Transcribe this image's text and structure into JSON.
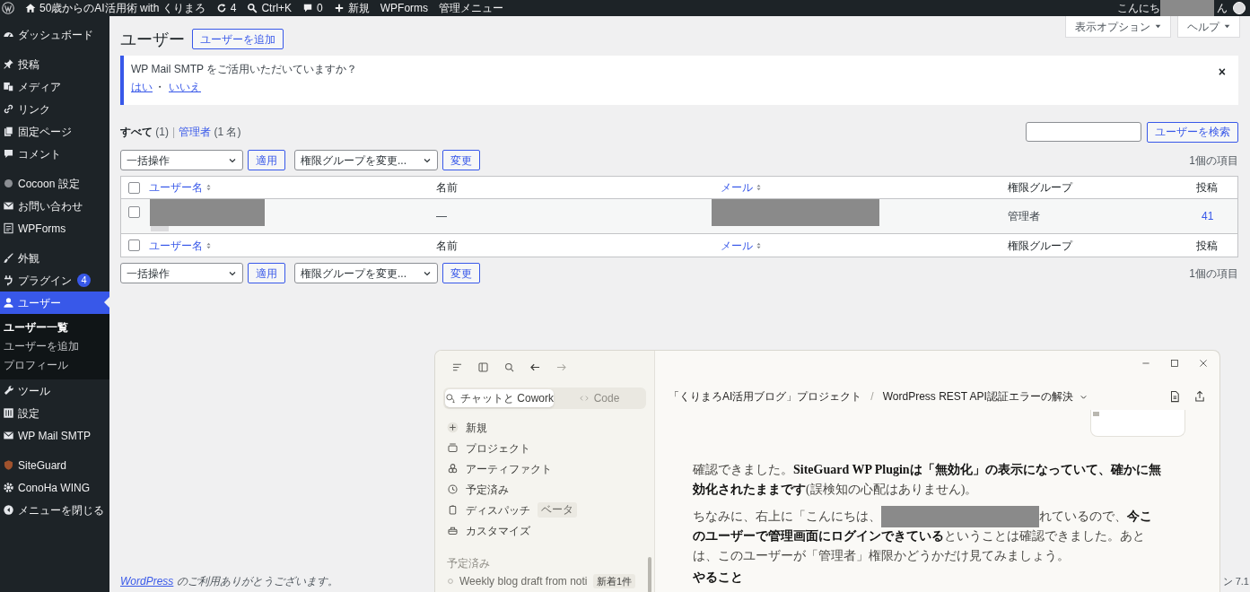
{
  "admin_bar": {
    "site_title": "50歳からのAI活用術 with くりまろ",
    "updates": "4",
    "search_shortcut": "Ctrl+K",
    "comments": "0",
    "new_label": "新規",
    "items": [
      "WPForms",
      "管理メニュー"
    ],
    "greeting_start": "こんにち",
    "greeting_end": "ん"
  },
  "sidebar": {
    "groups": [
      [
        {
          "label": "ダッシュボード",
          "selected": false
        }
      ],
      [
        {
          "label": "投稿",
          "selected": false
        },
        {
          "label": "メディア",
          "selected": false
        },
        {
          "label": "リンク",
          "selected": false
        },
        {
          "label": "固定ページ",
          "selected": false
        },
        {
          "label": "コメント",
          "selected": false
        }
      ],
      [
        {
          "label": "Cocoon 設定",
          "selected": false
        },
        {
          "label": "お問い合わせ",
          "selected": false
        },
        {
          "label": "WPForms",
          "selected": false
        }
      ],
      [
        {
          "label": "外観",
          "selected": false
        },
        {
          "label": "プラグイン",
          "badge": "4",
          "selected": false
        },
        {
          "label": "ユーザー",
          "selected": true,
          "children": [
            {
              "label": "ユーザー一覧",
              "selected": true
            },
            {
              "label": "ユーザーを追加",
              "selected": false
            },
            {
              "label": "プロフィール",
              "selected": false
            }
          ]
        },
        {
          "label": "ツール",
          "selected": false
        },
        {
          "label": "設定",
          "selected": false
        },
        {
          "label": "WP Mail SMTP",
          "selected": false
        }
      ],
      [
        {
          "label": "SiteGuard",
          "selected": false
        },
        {
          "label": "ConoHa WING",
          "selected": false
        },
        {
          "label": "メニューを閉じる",
          "selected": false
        }
      ]
    ]
  },
  "screen_tabs": [
    {
      "label": "表示オプション"
    },
    {
      "label": "ヘルプ"
    }
  ],
  "page": {
    "title": "ユーザー",
    "add_button": "ユーザーを追加"
  },
  "notice": {
    "message": "WP Mail SMTP をご活用いただいていますか？",
    "links": [
      "はい",
      "いいえ"
    ],
    "separator": "・",
    "dismiss": "×"
  },
  "filters": [
    {
      "label": "すべて",
      "count": "(1)",
      "selected": true
    },
    {
      "label": "管理者",
      "count": "(1 名)",
      "selected": false
    }
  ],
  "filter_separator": "|",
  "search": {
    "button": "ユーザーを検索"
  },
  "tablenav_top": {
    "bulk_action": "一括操作",
    "apply": "適用",
    "role_change": "権限グループを変更...",
    "change": "変更",
    "count": "1個の項目"
  },
  "table": {
    "header_checked": false,
    "columns": [
      {
        "label": "ユーザー名",
        "sortable": true
      },
      {
        "label": "名前",
        "sortable": false
      },
      {
        "label": "メール",
        "sortable": true
      },
      {
        "label": "権限グループ",
        "sortable": false
      },
      {
        "label": "投稿",
        "sortable": false
      }
    ],
    "rows": [
      {
        "checked": false,
        "cells": [
          {
            "kind": "user"
          },
          {
            "kind": "text",
            "text": "—"
          },
          {
            "kind": "redacted"
          },
          {
            "kind": "text",
            "text": "管理者"
          },
          {
            "kind": "link",
            "text": "41"
          }
        ]
      }
    ],
    "footer_checked": false,
    "footer_columns": [
      {
        "label": "ユーザー名",
        "sortable": true
      },
      {
        "label": "名前",
        "sortable": false
      },
      {
        "label": "メール",
        "sortable": true
      },
      {
        "label": "権限グループ",
        "sortable": false
      },
      {
        "label": "投稿",
        "sortable": false
      }
    ]
  },
  "tablenav_bottom": {
    "bulk_action": "一括操作",
    "apply": "適用",
    "role_change": "権限グループを変更...",
    "change": "変更",
    "count": "1個の項目"
  },
  "claude_window": {
    "mode_tabs": [
      {
        "label": "チャットと Cowork",
        "selected": true
      },
      {
        "label": "Code",
        "selected": false
      }
    ],
    "nav": [
      {
        "label": "新規"
      },
      {
        "label": "プロジェクト"
      },
      {
        "label": "アーティファクト"
      },
      {
        "label": "予定済み"
      },
      {
        "label": "ディスパッチ",
        "badge": "ベータ"
      },
      {
        "label": "カスタマイズ"
      }
    ],
    "section_label": "予定済み",
    "recent": [
      {
        "label": "Weekly blog draft from noti",
        "badge": "新着1件"
      }
    ],
    "breadcrumb": {
      "project": "「くりまろAI活用ブログ」プロジェクト",
      "separator": "/",
      "chat": "WordPress REST API認証エラーの解決"
    },
    "messages": [
      {
        "kind": "paragraph",
        "text": "確認できました。**SiteGuard WP Pluginは「無効化」の表示になっていて、確かに無効化されたままです**(誤検知の心配はありません)。"
      },
      {
        "kind": "redacted_line",
        "before": "ちなみに、右上に「こんにちは、",
        "after": "れているので、**今こ**"
      },
      {
        "kind": "paragraph",
        "text": "**のユーザーで管理画面にログインできている**ということは確認できました。あとは、このユーザーが「管理者」権限かどうかだけ見てみましょう。"
      },
      {
        "kind": "heading",
        "text": "やること"
      }
    ]
  },
  "footer": {
    "link": "WordPress",
    "text": " のご利用ありがとうございます。",
    "version": "ン 7.1"
  }
}
